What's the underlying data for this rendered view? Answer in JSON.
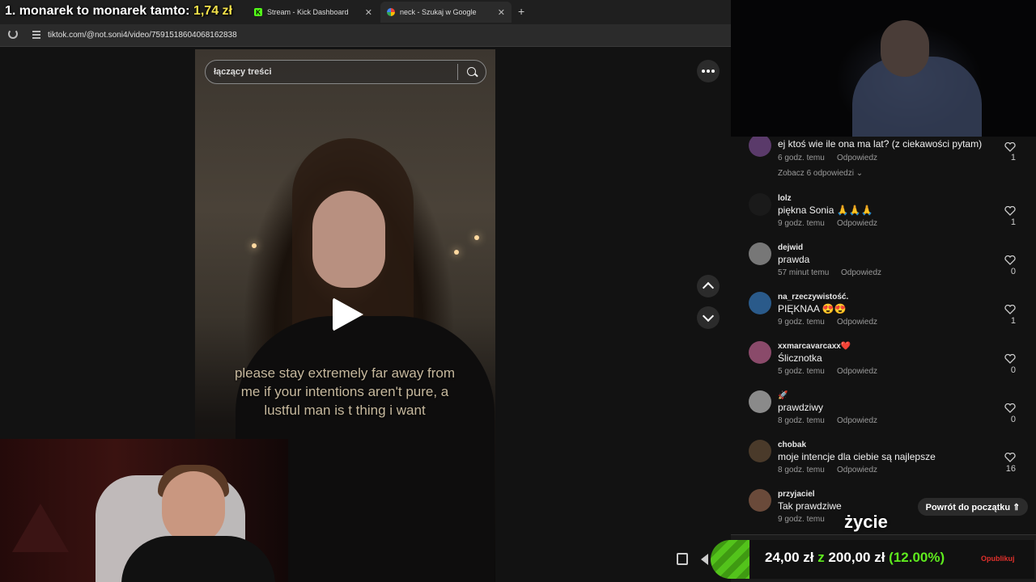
{
  "overlay": {
    "title_prefix": "1. monarek to monarek tamto:",
    "title_amount": "1,74 zł"
  },
  "tabs": [
    {
      "label": "Stream - Kick Dashboard"
    },
    {
      "label": "neck - Szukaj w Google"
    }
  ],
  "new_tab": "+",
  "address": {
    "url": "tiktok.com/@not.soni4/video/7591518604068162838"
  },
  "video": {
    "search_placeholder": "łączący treści",
    "caption": "please stay extremely far away from me if your intentions aren't pure, a lustful man is t thing i want"
  },
  "comments": [
    {
      "user": "",
      "text": "ej ktoś wie ile ona ma lat? (z ciekawości pytam)",
      "time": "6 godz. temu",
      "reply": "Odpowiedz",
      "likes": "1",
      "see_replies": "Zobacz 6 odpowiedzi ⌄",
      "avatar_color": "#5a3a6a"
    },
    {
      "user": "lolz",
      "text": "piękna Sonia 🙏🙏🙏",
      "time": "9 godz. temu",
      "reply": "Odpowiedz",
      "likes": "1",
      "avatar_color": "#1a1a1a"
    },
    {
      "user": "dejwid",
      "text": "prawda",
      "time": "57 minut temu",
      "reply": "Odpowiedz",
      "likes": "0",
      "avatar_color": "#777777"
    },
    {
      "user": "na_rzeczywistość.",
      "text": "PIĘKNAA 😍😍",
      "time": "9 godz. temu",
      "reply": "Odpowiedz",
      "likes": "1",
      "avatar_color": "#2a5a8a"
    },
    {
      "user": "xxmarcavarcaxx❤️",
      "text": "Ślicznotka",
      "time": "5 godz. temu",
      "reply": "Odpowiedz",
      "likes": "0",
      "avatar_color": "#8a4a6a"
    },
    {
      "user": "🚀",
      "text": "prawdziwy",
      "time": "8 godz. temu",
      "reply": "Odpowiedz",
      "likes": "0",
      "avatar_color": "#8a8a8a"
    },
    {
      "user": "chobak",
      "text": "moje intencje dla ciebie są najlepsze",
      "time": "8 godz. temu",
      "reply": "Odpowiedz",
      "likes": "16",
      "avatar_color": "#4a3a2a"
    },
    {
      "user": "przyjaciel",
      "text": "Tak prawdziwe",
      "time": "9 godz. temu",
      "reply": "",
      "likes": "",
      "avatar_color": "#6a4a3a"
    }
  ],
  "back_to_top": "Powrót do początku ⇑",
  "overlay_word": "życie",
  "donation": {
    "current": "24,00 zł",
    "separator": "z",
    "goal": "200,00 zł",
    "percent_label": "(12.00%)",
    "progress": 0.12,
    "publish": "Opublikuj"
  },
  "colors": {
    "accent_green": "#53c31b",
    "kick_green": "#53fc18",
    "publish_red": "#e0302c"
  }
}
